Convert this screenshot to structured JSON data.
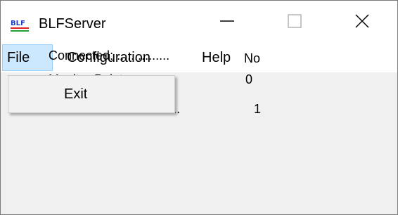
{
  "window": {
    "title": "BLFServer",
    "icon": "blf-app-icon",
    "controls": {
      "minimize_icon": "minimize-icon",
      "maximize_icon": "maximize-icon",
      "close_icon": "close-icon"
    }
  },
  "menubar": {
    "items": [
      {
        "label": "File",
        "active": true
      },
      {
        "label": "Configuration"
      },
      {
        "label": "Help"
      }
    ]
  },
  "dropdown": {
    "items": [
      {
        "label": "Exit"
      }
    ]
  },
  "status": {
    "connected": {
      "label": "Connected: ...............",
      "value": "No"
    },
    "monitor_points": {
      "label": "Monitor Points: ...........",
      "value": "0"
    },
    "connected_clients": {
      "label": "Connected Clients: ......",
      "value": "1"
    }
  },
  "colors": {
    "menu_active_bg": "#cce8ff",
    "menu_active_border": "#99d1ff",
    "client_area": "#f0f0f0",
    "icon_blue": "#1f3fbf",
    "icon_red": "#e0201f",
    "icon_green": "#21a03a"
  }
}
